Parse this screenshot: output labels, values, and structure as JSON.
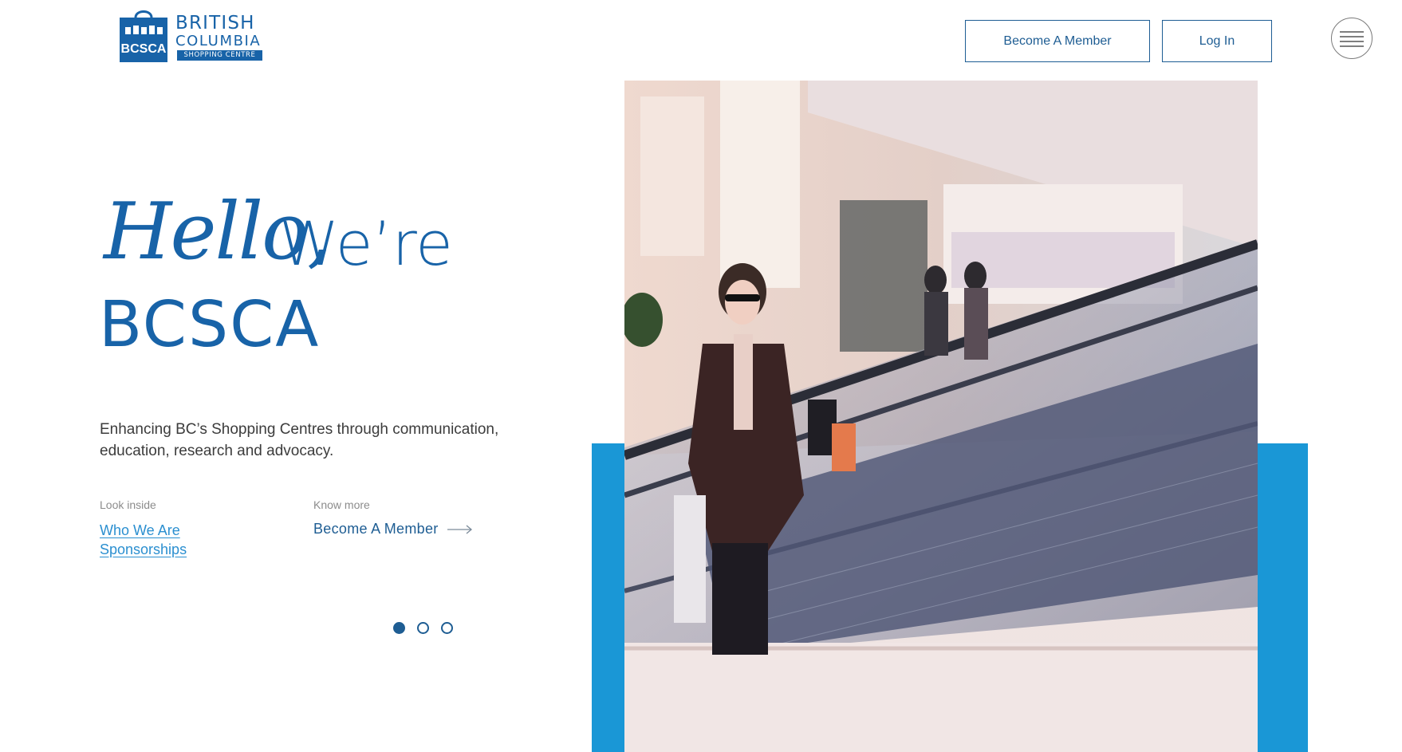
{
  "logo": {
    "badge_text": "BCSCA",
    "line1": "BRITISH",
    "line2": "COLUMBIA",
    "strip": "SHOPPING CENTRE"
  },
  "header": {
    "member_button": "Become A Member",
    "login_button": "Log In"
  },
  "hero": {
    "hello": "Hello,",
    "were": "We’re",
    "bcsca": "BCSCA",
    "tagline": "Enhancing BC’s Shopping Centres through communication, education, research and advocacy.",
    "look_inside_label": "Look inside",
    "links": [
      "Who We Are",
      "Sponsorships"
    ],
    "know_more_label": "Know more",
    "member_link": "Become A Member"
  },
  "carousel": {
    "dots": 3,
    "active_index": 0
  },
  "colors": {
    "brand_blue": "#1863a8",
    "button_blue": "#1e5d93",
    "accent_blue": "#1a97d6",
    "link_blue": "#2b8fd0"
  },
  "icons": [
    "shopping-bag-logo-icon",
    "hamburger-icon",
    "arrow-right-icon"
  ]
}
